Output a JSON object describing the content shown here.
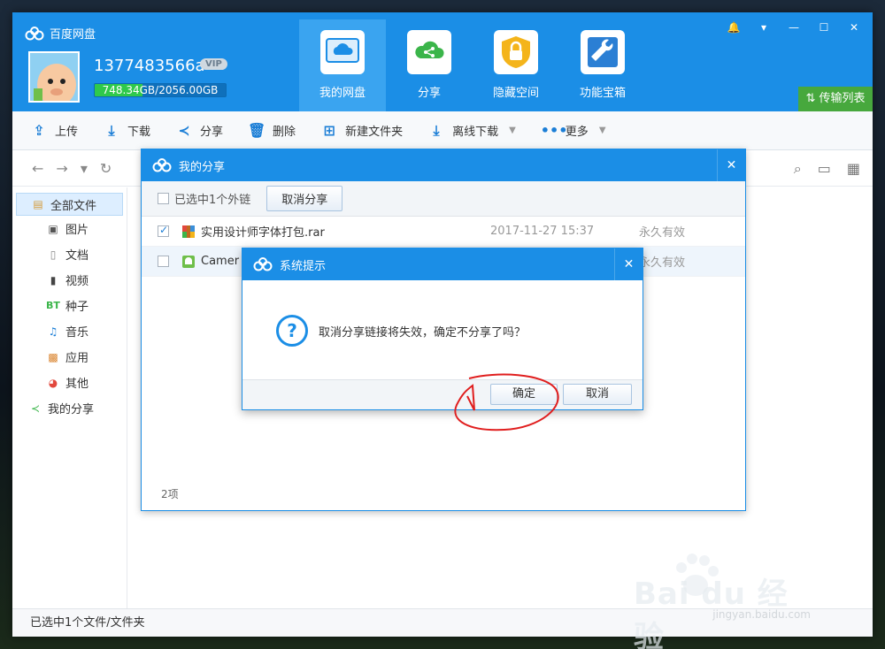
{
  "app": {
    "brand": "百度网盘",
    "username": "1377483566a",
    "vip_badge": "VIP",
    "quota_text": "748.34GB/2056.00GB",
    "quota_fraction": 0.364,
    "transfer_label": "传输列表"
  },
  "nav_tabs": [
    {
      "label": "我的网盘",
      "icon": "cloud-disk-icon"
    },
    {
      "label": "分享",
      "icon": "share-icon"
    },
    {
      "label": "隐藏空间",
      "icon": "lock-icon"
    },
    {
      "label": "功能宝箱",
      "icon": "wrench-icon"
    }
  ],
  "toolbar": [
    {
      "label": "上传",
      "icon": "upload-icon"
    },
    {
      "label": "下载",
      "icon": "download-icon"
    },
    {
      "label": "分享",
      "icon": "share-icon"
    },
    {
      "label": "删除",
      "icon": "trash-icon"
    },
    {
      "label": "新建文件夹",
      "icon": "new-folder-icon"
    },
    {
      "label": "离线下载",
      "icon": "offline-download-icon"
    },
    {
      "label": "更多",
      "icon": "more-icon"
    }
  ],
  "sidebar": [
    {
      "label": "全部文件"
    },
    {
      "label": "图片"
    },
    {
      "label": "文档"
    },
    {
      "label": "视频"
    },
    {
      "label": "种子",
      "badge": "BT"
    },
    {
      "label": "音乐"
    },
    {
      "label": "应用"
    },
    {
      "label": "其他"
    },
    {
      "label": "我的分享"
    }
  ],
  "status": "已选中1个文件/文件夹",
  "share_dialog": {
    "title": "我的分享",
    "selected_text": "已选中1个外链",
    "cancel_share_button": "取消分享",
    "files": [
      {
        "name": "实用设计师字体打包.rar",
        "date": "2017-11-27 15:37",
        "expiry": "永久有效",
        "checked": true
      },
      {
        "name": "Camer",
        "date": "",
        "expiry": "永久有效",
        "checked": false
      }
    ],
    "count": "2项"
  },
  "system_dialog": {
    "title": "系统提示",
    "message": "取消分享链接将失效，确定不分享了吗？",
    "ok": "确定",
    "cancel": "取消"
  },
  "watermark": {
    "brand": "Bai du 经验",
    "url": "jingyan.baidu.com"
  },
  "colors": {
    "header": "#1b8ee6",
    "accent": "#3aa4f0",
    "transfer": "#47a83d",
    "quota_fill": "#2fc94c"
  }
}
